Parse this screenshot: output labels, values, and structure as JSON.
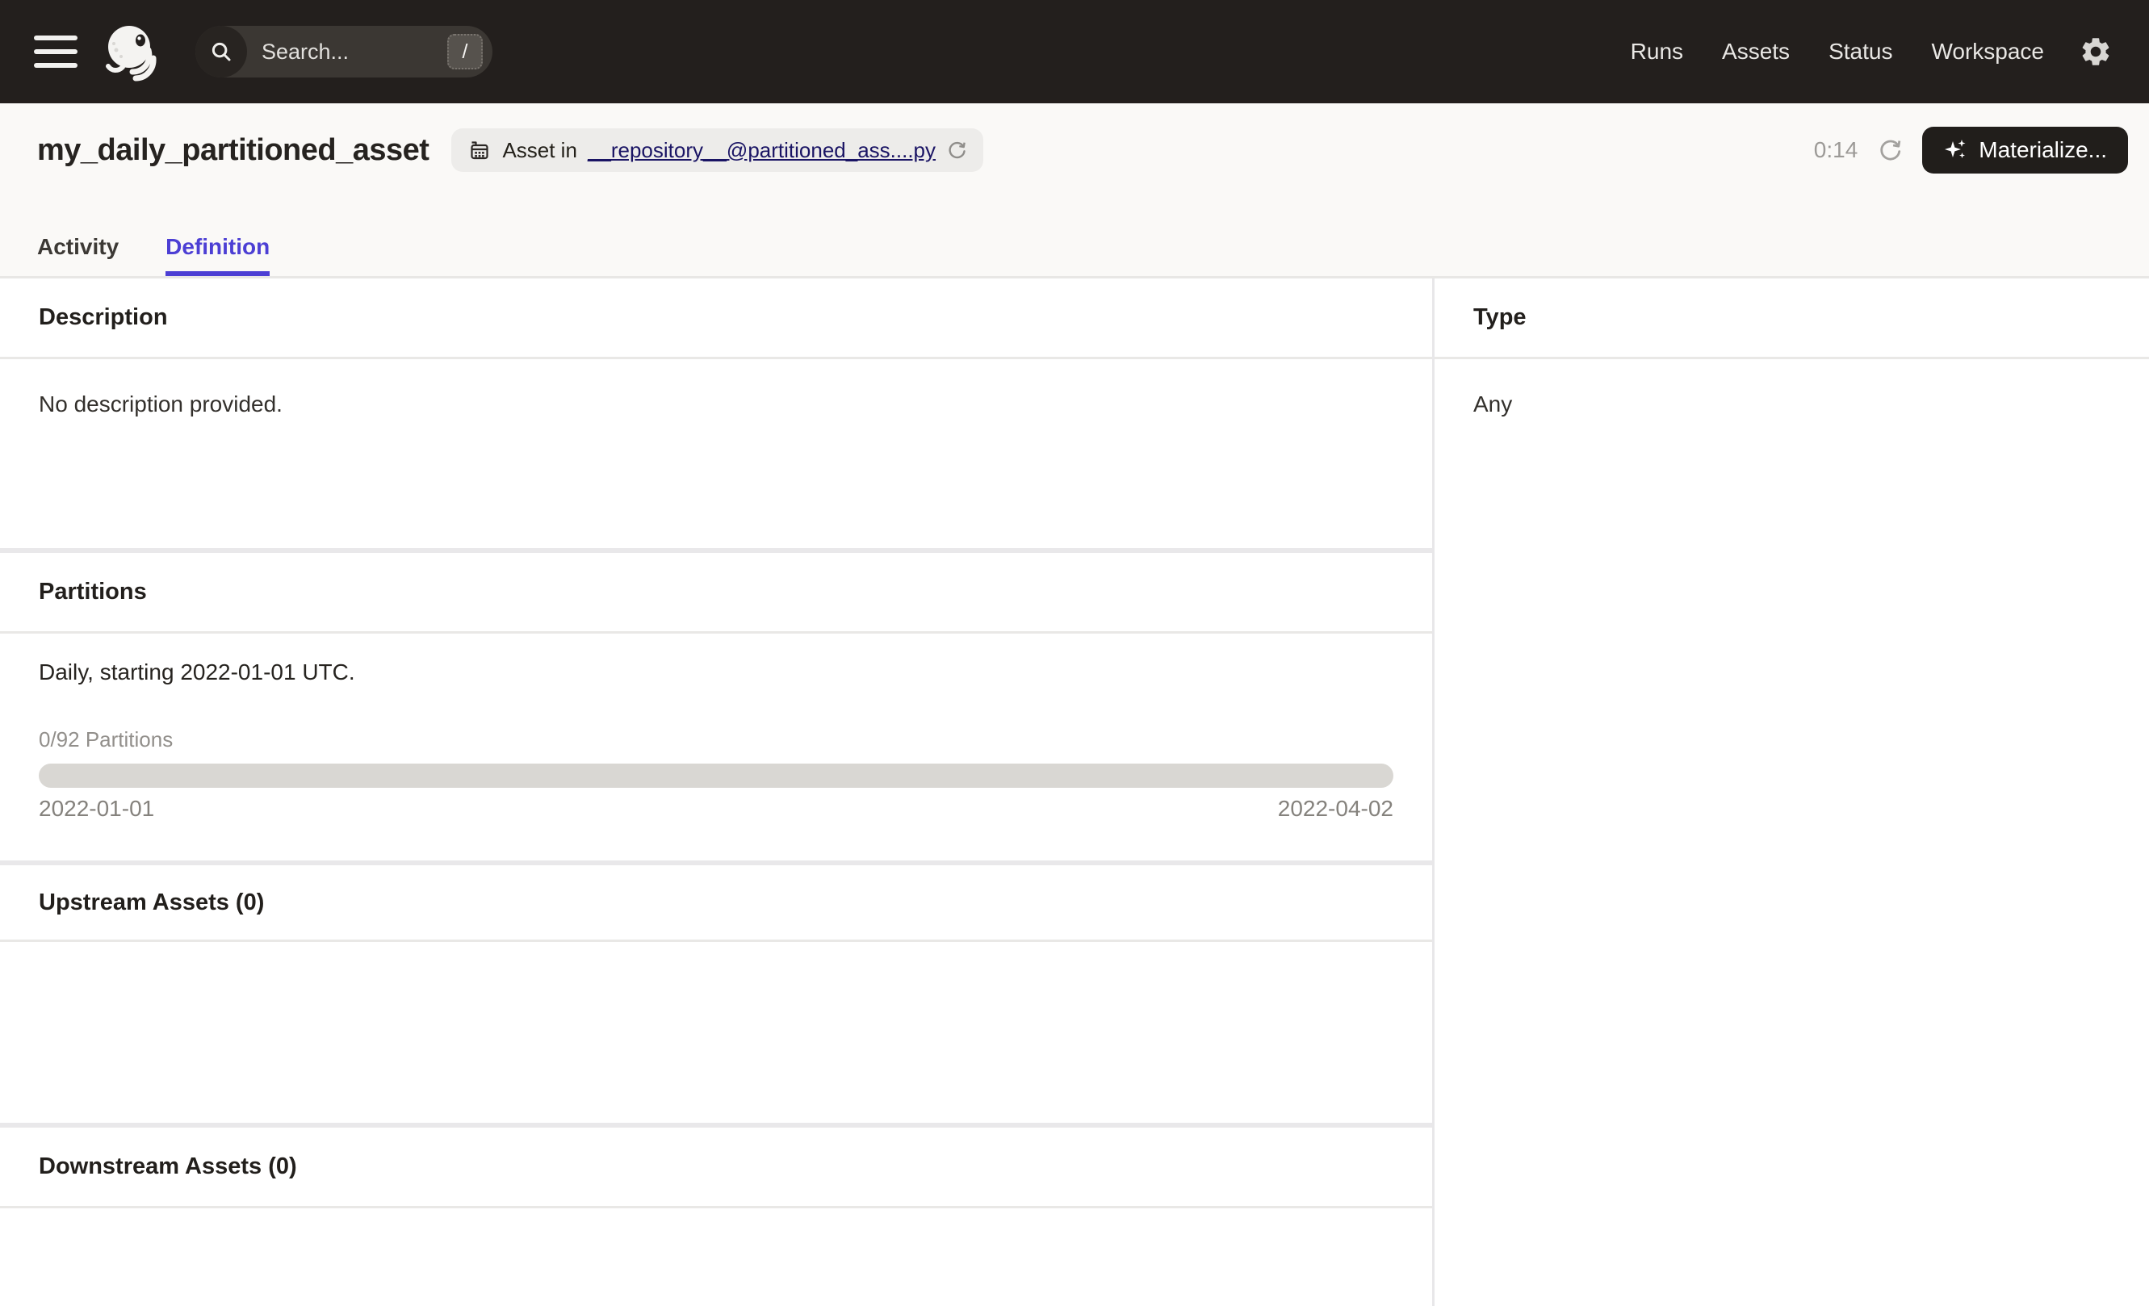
{
  "navbar": {
    "search": {
      "placeholder": "Search...",
      "shortcut": "/"
    },
    "links": [
      {
        "label": "Runs"
      },
      {
        "label": "Assets"
      },
      {
        "label": "Status"
      },
      {
        "label": "Workspace"
      }
    ]
  },
  "header": {
    "title": "my_daily_partitioned_asset",
    "badge": {
      "prefix": "Asset in",
      "link": "__repository__@partitioned_ass....py"
    },
    "refresh_timer": "0:14",
    "materialize_label": "Materialize..."
  },
  "tabs": [
    {
      "label": "Activity"
    },
    {
      "label": "Definition"
    }
  ],
  "left": {
    "description": {
      "title": "Description",
      "body": "No description provided."
    },
    "partitions": {
      "title": "Partitions",
      "summary": "Daily, starting 2022-01-01 UTC.",
      "progress_label": "0/92 Partitions",
      "progress_percent": 0,
      "range_start": "2022-01-01",
      "range_end": "2022-04-02"
    },
    "upstream": {
      "title": "Upstream Assets (0)"
    },
    "downstream": {
      "title": "Downstream Assets (0)"
    }
  },
  "right": {
    "type": {
      "title": "Type",
      "value": "Any"
    }
  },
  "colors": {
    "navbar_bg": "#231f1d",
    "accent": "#4c3fd4",
    "header_bg": "#faf9f7",
    "badge_link": "#1a1464",
    "materialize_bg": "#211e1b",
    "progress_track": "#d9d7d3",
    "border": "#e8e7e5"
  }
}
